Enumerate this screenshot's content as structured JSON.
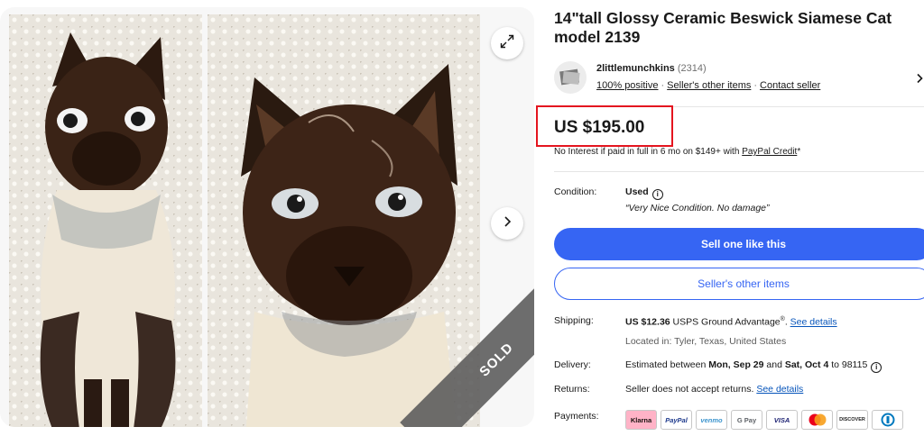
{
  "listing": {
    "title": "14\"tall Glossy Ceramic Beswick Siamese Cat model 2139",
    "sold_label": "SOLD"
  },
  "seller": {
    "name": "2littlemunchkins",
    "count": "(2314)",
    "positive": "100% positive",
    "other_items_link": "Seller's other items",
    "contact_link": "Contact seller"
  },
  "price": {
    "amount": "US $195.00",
    "credit_text": "No Interest if paid in full in 6 mo on $149+ with ",
    "credit_link": "PayPal Credit",
    "credit_suffix": "*"
  },
  "condition": {
    "label": "Condition:",
    "value": "Used",
    "note": "“Very Nice Condition. No damage”"
  },
  "actions": {
    "sell_one": "Sell one like this",
    "sellers_other_items": "Seller's other items"
  },
  "shipping": {
    "label": "Shipping:",
    "cost": "US $12.36",
    "service": "USPS Ground Advantage",
    "trademark": "®",
    "separator": ".",
    "details_link": "See details",
    "location": "Located in: Tyler, Texas, United States"
  },
  "delivery": {
    "label": "Delivery:",
    "prefix": "Estimated between ",
    "date_start": "Mon, Sep 29",
    "and": " and ",
    "date_end": "Sat, Oct 4",
    "suffix": " to 98115"
  },
  "returns": {
    "label": "Returns:",
    "text": "Seller does not accept returns. ",
    "details_link": "See details"
  },
  "payments": {
    "label": "Payments:",
    "methods": [
      {
        "name": "Klarna",
        "color": "#ffb3c7",
        "text_color": "#17120f"
      },
      {
        "name": "PayPal",
        "color": "#ffffff",
        "text_color": "#1f3b8d"
      },
      {
        "name": "venmo",
        "color": "#ffffff",
        "text_color": "#3d95ce"
      },
      {
        "name": "G Pay",
        "color": "#ffffff",
        "text_color": "#5f6368"
      },
      {
        "name": "VISA",
        "color": "#ffffff",
        "text_color": "#1a1f71"
      },
      {
        "name": "",
        "color": "#ffffff",
        "text_color": "#eb001b"
      },
      {
        "name": "DISCOVER",
        "color": "#ffffff",
        "text_color": "#222222"
      },
      {
        "name": "",
        "color": "#ffffff",
        "text_color": "#0079be"
      }
    ]
  },
  "icons": {
    "expand": "expand-icon",
    "next": "chevron-right-icon",
    "info": "info-icon",
    "seller_chevron": "chevron-right-icon"
  },
  "colors": {
    "primary": "#3665f3",
    "highlight_box": "#e4151f",
    "link": "#0654ba"
  }
}
